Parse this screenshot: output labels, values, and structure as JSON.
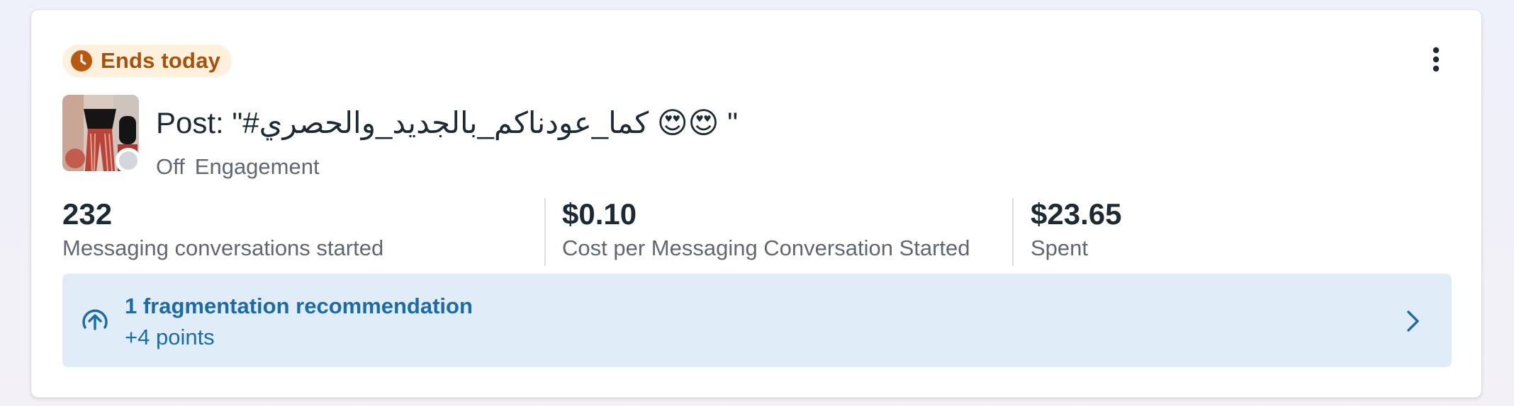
{
  "badge": {
    "label": "Ends today",
    "color": "#a8510b",
    "background": "#fdf0dd",
    "icon": "clock-icon"
  },
  "post": {
    "title": "Post: \"#كما_عودناكم_بالجديد_والحصري 😍😍 \"",
    "status": "Off",
    "objective": "Engagement"
  },
  "metrics": [
    {
      "value": "232",
      "label": "Messaging conversations started"
    },
    {
      "value": "$0.10",
      "label": "Cost per Messaging Conversation Started"
    },
    {
      "value": "$23.65",
      "label": "Spent"
    }
  ],
  "recommendation": {
    "title": "1 fragmentation recommendation",
    "subtitle": "+4 points",
    "icon": "arrow-up-circle-icon",
    "color": "#1a6ba6"
  },
  "menu": {
    "icon": "more-vertical-icon"
  }
}
